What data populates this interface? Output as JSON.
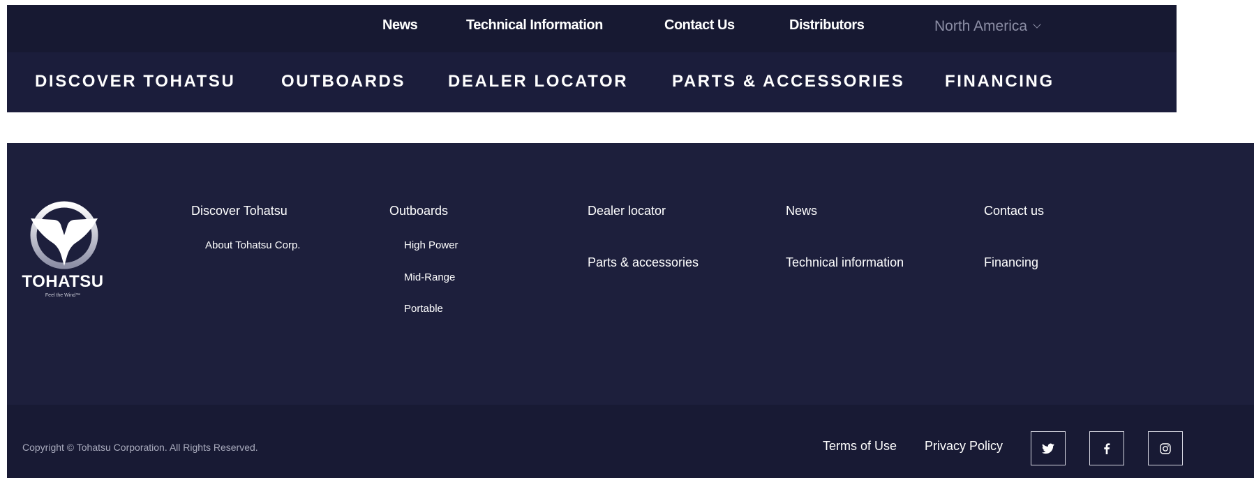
{
  "header": {
    "utility_links": [
      "News",
      "Technical Information",
      "Contact Us",
      "Distributors"
    ],
    "region": {
      "label": "North America",
      "icon": "chevron-down-icon"
    },
    "main_nav": [
      "DISCOVER TOHATSU",
      "OUTBOARDS",
      "DEALER LOCATOR",
      "PARTS & ACCESSORIES",
      "FINANCING"
    ]
  },
  "footer": {
    "logo": {
      "wordmark": "TOHATSU",
      "tagline": "Feel the Wind™"
    },
    "columns": {
      "discover": {
        "title": "Discover Tohatsu",
        "items": [
          "About Tohatsu Corp."
        ]
      },
      "outboards": {
        "title": "Outboards",
        "items": [
          "High Power",
          "Mid-Range",
          "Portable"
        ]
      },
      "dealer": {
        "title": "Dealer locator",
        "second": "Parts & accessories"
      },
      "news": {
        "title": "News",
        "second": "Technical information"
      },
      "contact": {
        "title": "Contact us",
        "second": "Financing"
      }
    },
    "copyright": "Copyright © Tohatsu Corporation. All Rights Reserved.",
    "legal": {
      "terms": "Terms of Use",
      "privacy": "Privacy Policy"
    },
    "social": [
      "twitter-icon",
      "facebook-icon",
      "instagram-icon"
    ]
  },
  "colors": {
    "header_bg": "#1b1d3b",
    "utility_bg": "#171932",
    "footer_bg": "#1d1f3c",
    "footer_bottom_bg": "#181a34",
    "text": "#ffffff",
    "muted": "#8d8fa6"
  }
}
